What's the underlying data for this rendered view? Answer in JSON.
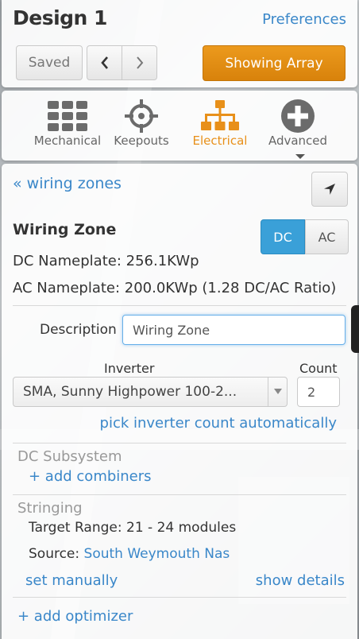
{
  "header": {
    "title": "Design 1",
    "preferences_label": "Preferences",
    "saved_label": "Saved",
    "showing_array_label": "Showing Array"
  },
  "tabs": [
    {
      "label": "Mechanical",
      "icon": "grid-icon"
    },
    {
      "label": "Keepouts",
      "icon": "crosshair-icon"
    },
    {
      "label": "Electrical",
      "icon": "tree-icon",
      "active": true
    },
    {
      "label": "Advanced",
      "icon": "plus-circle-icon"
    }
  ],
  "zone": {
    "back_link": "« wiring zones",
    "title": "Wiring Zone",
    "toggle_dc": "DC",
    "toggle_ac": "AC",
    "dc_nameplate": "DC Nameplate: 256.1KWp",
    "ac_nameplate": "AC Nameplate: 200.0KWp (1.28 DC/AC Ratio)",
    "description_label": "Description",
    "description_value": "Wiring Zone",
    "inverter_label": "Inverter",
    "count_label": "Count",
    "inverter_value": "SMA, Sunny Highpower 100-2...",
    "count_value": "2",
    "pick_auto": "pick inverter count automatically"
  },
  "dc_subsystem": {
    "title": "DC Subsystem",
    "add_combiners": "+ add combiners"
  },
  "stringing": {
    "title": "Stringing",
    "target_range": "Target Range: 21 - 24 modules",
    "source_label": "Source:",
    "source_value": "South Weymouth Nas",
    "set_manually": "set manually",
    "show_details": "show details"
  },
  "add_optimizer": "+ add optimizer",
  "colors": {
    "accent_blue": "#3a87c9",
    "active_orange": "#e8901a",
    "toggle_active": "#3aa0d8"
  }
}
